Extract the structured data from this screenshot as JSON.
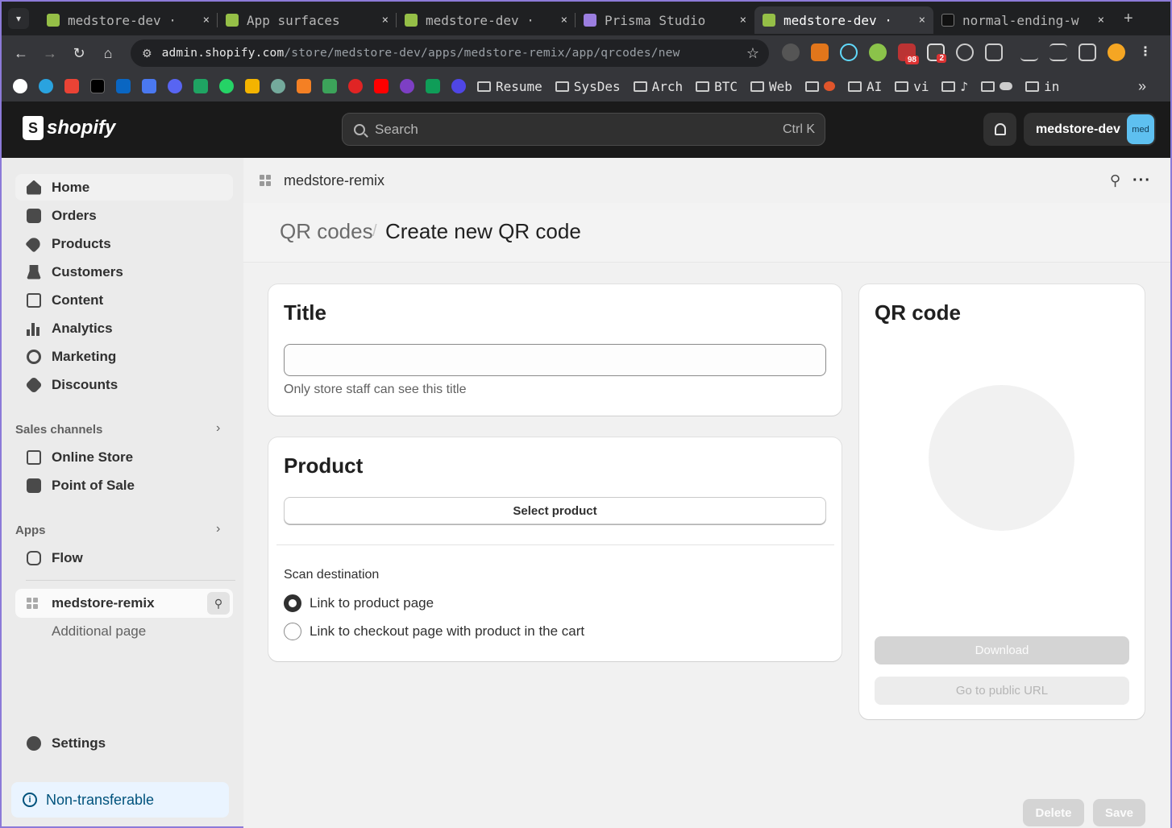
{
  "browser": {
    "tabs": [
      {
        "label": "medstore-dev ·",
        "active": false
      },
      {
        "label": "App surfaces",
        "active": false
      },
      {
        "label": "medstore-dev ·",
        "active": false
      },
      {
        "label": "Prisma Studio",
        "active": false
      },
      {
        "label": "medstore-dev ·",
        "active": true
      },
      {
        "label": "normal-ending-w",
        "active": false
      }
    ],
    "url_host": "admin.shopify.com",
    "url_path": "/store/medstore-dev/apps/medstore-remix/app/qrcodes/new",
    "extension_badges": {
      "ext_a": "98",
      "ext_b": "2"
    },
    "bookmark_folders": [
      "Resume",
      "SysDes",
      "Arch",
      "BTC",
      "Web",
      "",
      "AI",
      "vi",
      "♪",
      "",
      "in"
    ],
    "close_glyph": "×",
    "new_tab_glyph": "+"
  },
  "shopify": {
    "brand": "shopify",
    "search_placeholder": "Search",
    "search_shortcut": "Ctrl K",
    "store_name": "medstore-dev",
    "avatar_text": "med"
  },
  "sidebar": {
    "items": [
      {
        "label": "Home",
        "icon": "home-icon"
      },
      {
        "label": "Orders",
        "icon": "inbox-icon"
      },
      {
        "label": "Products",
        "icon": "tag-icon"
      },
      {
        "label": "Customers",
        "icon": "person-icon"
      },
      {
        "label": "Content",
        "icon": "image-icon"
      },
      {
        "label": "Analytics",
        "icon": "bar-chart-icon"
      },
      {
        "label": "Marketing",
        "icon": "target-icon"
      },
      {
        "label": "Discounts",
        "icon": "discount-icon"
      }
    ],
    "sales_channels_label": "Sales channels",
    "sales_channels": [
      {
        "label": "Online Store",
        "icon": "store-icon"
      },
      {
        "label": "Point of Sale",
        "icon": "pos-icon"
      }
    ],
    "apps_label": "Apps",
    "apps": [
      {
        "label": "Flow",
        "icon": "flow-icon"
      }
    ],
    "active_app": "medstore-remix",
    "active_app_subpage": "Additional page",
    "settings_label": "Settings",
    "notice": "Non-transferable"
  },
  "app": {
    "name": "medstore-remix",
    "breadcrumb": "QR codes",
    "page_title": "Create new QR code",
    "title_card": {
      "heading": "Title",
      "input_value": "",
      "help_text": "Only store staff can see this title"
    },
    "product_card": {
      "heading": "Product",
      "select_button": "Select product",
      "scan_destination_label": "Scan destination",
      "options": [
        {
          "label": "Link to product page",
          "selected": true
        },
        {
          "label": "Link to checkout page with product in the cart",
          "selected": false
        }
      ]
    },
    "qr_card": {
      "heading": "QR code",
      "download_button": "Download",
      "public_url_button": "Go to public URL"
    },
    "delete_button": "Delete",
    "save_button": "Save"
  }
}
